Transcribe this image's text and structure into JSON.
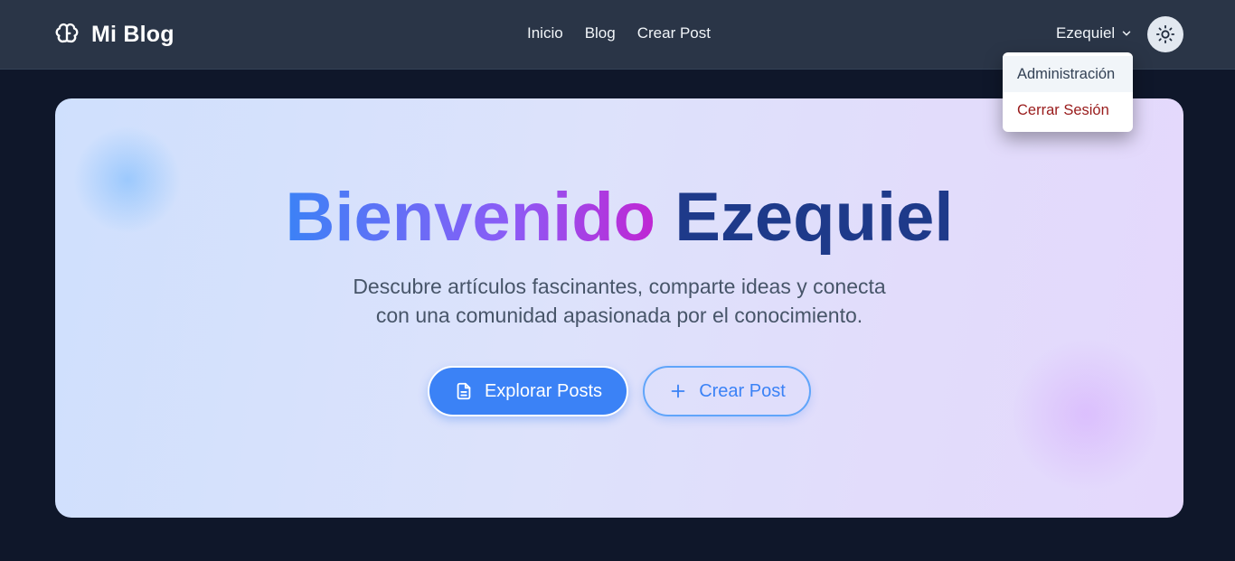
{
  "brand": {
    "name": "Mi Blog",
    "icon": "brain-icon"
  },
  "nav": {
    "links": [
      {
        "label": "Inicio"
      },
      {
        "label": "Blog"
      },
      {
        "label": "Crear Post"
      }
    ]
  },
  "user": {
    "name": "Ezequiel",
    "menu": {
      "admin_label": "Administración",
      "logout_label": "Cerrar Sesión"
    }
  },
  "theme_toggle": {
    "icon": "sun-icon"
  },
  "hero": {
    "greeting": "Bienvenido",
    "name": "Ezequiel",
    "subtitle_line1": "Descubre artículos fascinantes, comparte ideas y conecta",
    "subtitle_line2": "con una comunidad apasionada por el conocimiento.",
    "primary_button": "Explorar Posts",
    "secondary_button": "Crear Post"
  },
  "colors": {
    "navbar": "#2a3547",
    "background": "#0f172a",
    "accent": "#3b82f6",
    "name_color": "#1e3a8a",
    "logout": "#991b1b"
  }
}
